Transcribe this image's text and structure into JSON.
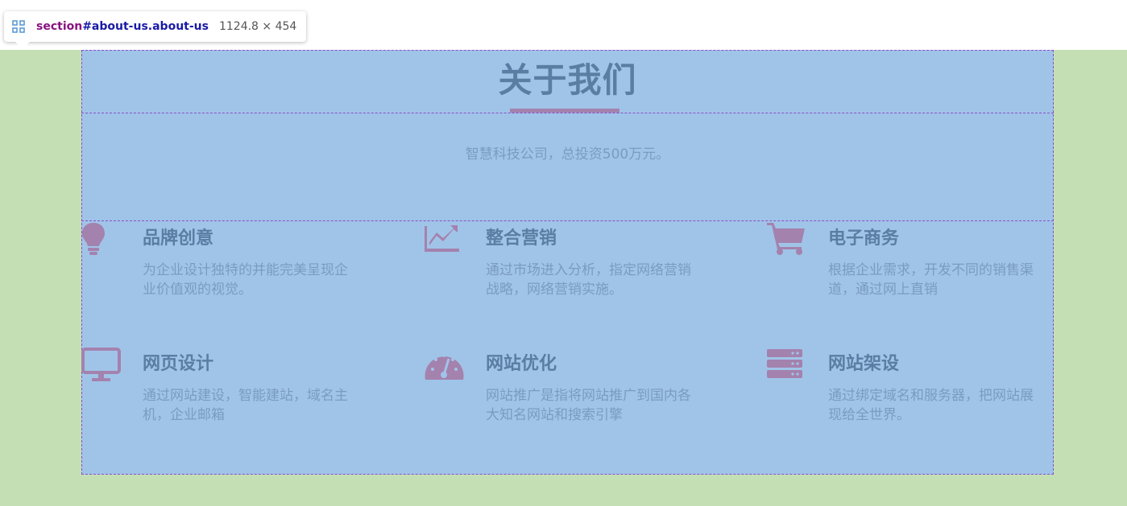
{
  "tooltip": {
    "tag": "section",
    "selector": "#about-us.about-us",
    "size": "1124.8 × 454"
  },
  "section": {
    "title": "关于我们",
    "intro": "智慧科技公司，总投资500万元。"
  },
  "features": [
    {
      "icon": "lightbulb-icon",
      "title": "品牌创意",
      "desc": "为企业设计独特的并能完美呈现企业价值观的视觉。"
    },
    {
      "icon": "chart-line-icon",
      "title": "整合营销",
      "desc": "通过市场进入分析，指定网络营销战略，网络营销实施。"
    },
    {
      "icon": "shopping-cart-icon",
      "title": "电子商务",
      "desc": "根据企业需求，开发不同的销售渠道，通过网上直销"
    },
    {
      "icon": "desktop-icon",
      "title": "网页设计",
      "desc": "通过网站建设，智能建站，域名主机，企业邮箱"
    },
    {
      "icon": "tachometer-icon",
      "title": "网站优化",
      "desc": "网站推广是指将网站推广到国内各大知名网站和搜索引擎"
    },
    {
      "icon": "server-icon",
      "title": "网站架设",
      "desc": "通过绑定域名和服务器，把网站展现给全世界。"
    }
  ],
  "colors": {
    "margin_overlay": "#c5dfb5",
    "content_overlay": "#a0c4e8",
    "icon": "#a482ae",
    "heading": "#5a7ea3",
    "text": "#7a9bc0"
  }
}
